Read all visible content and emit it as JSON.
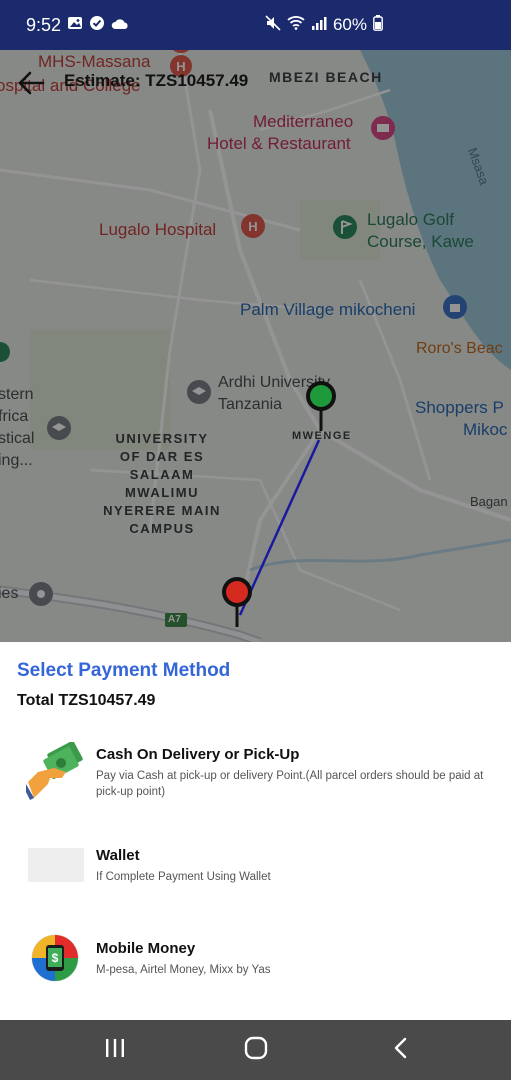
{
  "status_bar": {
    "time": "9:52",
    "battery": "60%",
    "left_icons": [
      "gallery-icon",
      "check-circle-icon",
      "cloud-icon"
    ],
    "right_icons": [
      "mute-icon",
      "wifi-icon",
      "signal-icon",
      "battery-icon"
    ]
  },
  "header": {
    "estimate": "Estimate: TZS10457.49",
    "back_icon": "arrow-left-icon"
  },
  "map": {
    "labels": {
      "mhs": "MHS-Massana",
      "hospital_college": "ospital and College",
      "mbezi": "MBEZI BEACH",
      "mediterraneo_1": "Mediterraneo",
      "mediterraneo_2": "Hotel & Restaurant",
      "msasani": "Msasa",
      "lugalo_hospital": "Lugalo Hospital",
      "lugalo_golf_1": "Lugalo Golf",
      "lugalo_golf_2": "Course, Kawe",
      "palm_village": "Palm Village mikocheni",
      "roros": "Roro's Beac",
      "ardhi_1": "Ardhi University",
      "ardhi_2": "Tanzania",
      "shoppers_1": "Shoppers P",
      "shoppers_2": "Mikoc",
      "stern_1": "stern",
      "stern_2": "frica",
      "stern_3": "stical",
      "stern_4": "ing...",
      "udsm_1": "UNIVERSITY",
      "udsm_2": "OF DAR ES",
      "udsm_3": "SALAAM",
      "udsm_4": "MWALIMU",
      "udsm_5": "NYERERE MAIN",
      "udsm_6": "CAMPUS",
      "mwenge": "MWENGE",
      "bagan": "Bagan",
      "ies": "ies",
      "road_shield": "A7"
    },
    "route_color": "#1a1aa0",
    "pickup_pin_color": "#1f9a3a",
    "dropoff_pin_color": "#d42a1f"
  },
  "payment": {
    "title": "Select Payment Method",
    "total": "Total TZS10457.49",
    "methods": [
      {
        "title": "Cash On Delivery or Pick-Up",
        "description": "Pay via Cash at pick-up or delivery Point.(All parcel orders should be paid at pick-up point)",
        "icon": "cash-hand-icon"
      },
      {
        "title": "Wallet",
        "description": "If Complete Payment Using Wallet",
        "icon": "wallet-placeholder-icon"
      },
      {
        "title": "Mobile Money",
        "description": "M-pesa, Airtel Money, Mixx by Yas",
        "icon": "mobile-money-icon"
      }
    ]
  },
  "nav": {
    "recent": "recent-apps-icon",
    "home": "home-icon",
    "back": "back-chevron-icon"
  },
  "colors": {
    "status_bar_bg": "#1a2a6c",
    "accent": "#3466d8",
    "nav_bg": "#4a4a4a"
  }
}
